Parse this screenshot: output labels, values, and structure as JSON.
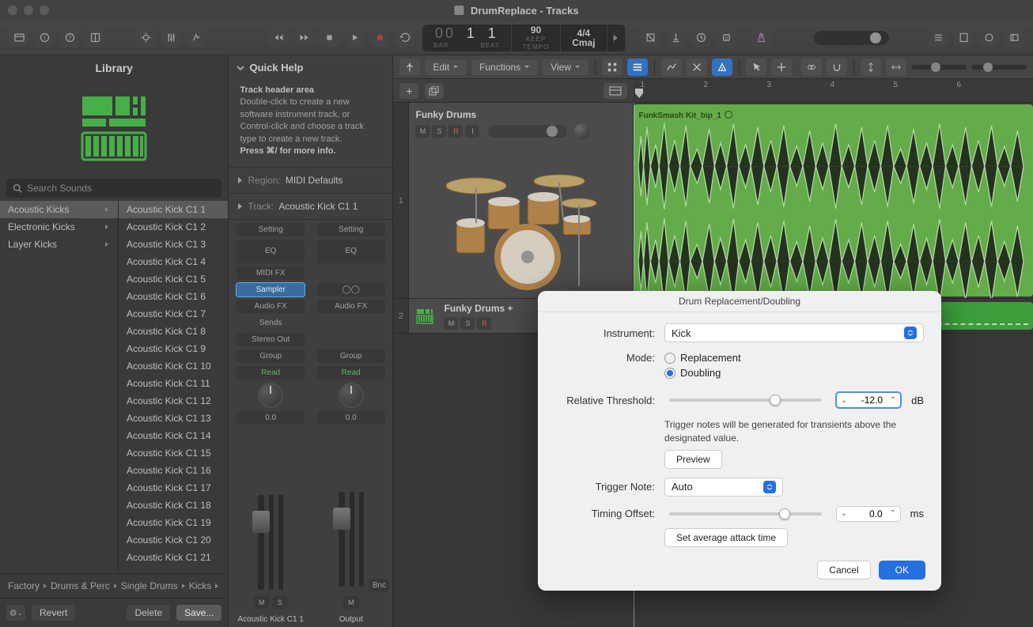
{
  "window": {
    "title": "DrumReplace - Tracks"
  },
  "lcd": {
    "bars": "00",
    "beat": "1",
    "division": "1",
    "bar_label": "BAR",
    "beat_label": "BEAT",
    "tempo": "90",
    "tempo_mode": "KEEP",
    "tempo_label": "TEMPO",
    "sig": "4/4",
    "key": "Cmaj"
  },
  "library": {
    "title": "Library",
    "search_placeholder": "Search Sounds",
    "categories": [
      {
        "name": "Acoustic Kicks",
        "selected": true
      },
      {
        "name": "Electronic Kicks",
        "selected": false
      },
      {
        "name": "Layer Kicks",
        "selected": false
      }
    ],
    "presets": [
      "Acoustic Kick C1 1",
      "Acoustic Kick C1 2",
      "Acoustic Kick C1 3",
      "Acoustic Kick C1 4",
      "Acoustic Kick C1 5",
      "Acoustic Kick C1 6",
      "Acoustic Kick C1 7",
      "Acoustic Kick C1 8",
      "Acoustic Kick C1 9",
      "Acoustic Kick C1 10",
      "Acoustic Kick C1 11",
      "Acoustic Kick C1 12",
      "Acoustic Kick C1 13",
      "Acoustic Kick C1 14",
      "Acoustic Kick C1 15",
      "Acoustic Kick C1 16",
      "Acoustic Kick C1 17",
      "Acoustic Kick C1 18",
      "Acoustic Kick C1 19",
      "Acoustic Kick C1 20",
      "Acoustic Kick C1 21"
    ],
    "selected_preset": 0,
    "breadcrumb": [
      "Factory",
      "Drums & Perc",
      "Single Drums",
      "Kicks"
    ],
    "revert": "Revert",
    "delete": "Delete",
    "save": "Save..."
  },
  "quick_help": {
    "title": "Quick Help",
    "heading": "Track header area",
    "body": "Double-click to create a new software instrument track, or Control-click and choose a track type to create a new track.",
    "footer": "Press ⌘/ for more info."
  },
  "inspector": {
    "region_label": "Region:",
    "region_value": "MIDI Defaults",
    "track_label": "Track:",
    "track_value": "Acoustic Kick C1 1",
    "strip1": {
      "setting": "Setting",
      "eq": "EQ",
      "midifx": "MIDI FX",
      "inst": "Sampler",
      "audiofx": "Audio FX",
      "sends": "Sends",
      "out": "Stereo Out",
      "group": "Group",
      "auto": "Read",
      "db": "0.0",
      "name": "Acoustic Kick C1 1",
      "m": "M",
      "s": "S"
    },
    "strip2": {
      "setting": "Setting",
      "eq": "EQ",
      "audiofx": "Audio FX",
      "group": "Group",
      "auto": "Read",
      "db": "0.0",
      "bnc": "Bnc",
      "name": "Output",
      "m": "M"
    }
  },
  "tracks_toolbar": {
    "edit": "Edit",
    "functions": "Functions",
    "view": "View"
  },
  "ruler": [
    "1",
    "2",
    "3",
    "4",
    "5",
    "6"
  ],
  "track1": {
    "num": "1",
    "name": "Funky Drums",
    "m": "M",
    "s": "S",
    "r": "R",
    "i": "I",
    "region_name": "FunkSmash Kit_bip_1"
  },
  "track2": {
    "num": "2",
    "name": "Funky Drums +",
    "m": "M",
    "s": "S",
    "r": "R"
  },
  "dialog": {
    "title": "Drum Replacement/Doubling",
    "instrument_label": "Instrument:",
    "instrument_value": "Kick",
    "mode_label": "Mode:",
    "mode_replacement": "Replacement",
    "mode_doubling": "Doubling",
    "mode_selected": "Doubling",
    "threshold_label": "Relative Threshold:",
    "threshold_value": "-12.0",
    "threshold_unit": "dB",
    "threshold_help": "Trigger notes will be generated for transients above the designated value.",
    "preview": "Preview",
    "trigger_label": "Trigger Note:",
    "trigger_value": "Auto",
    "offset_label": "Timing Offset:",
    "offset_value": "0.0",
    "offset_unit": "ms",
    "attack_btn": "Set average attack time",
    "cancel": "Cancel",
    "ok": "OK"
  }
}
